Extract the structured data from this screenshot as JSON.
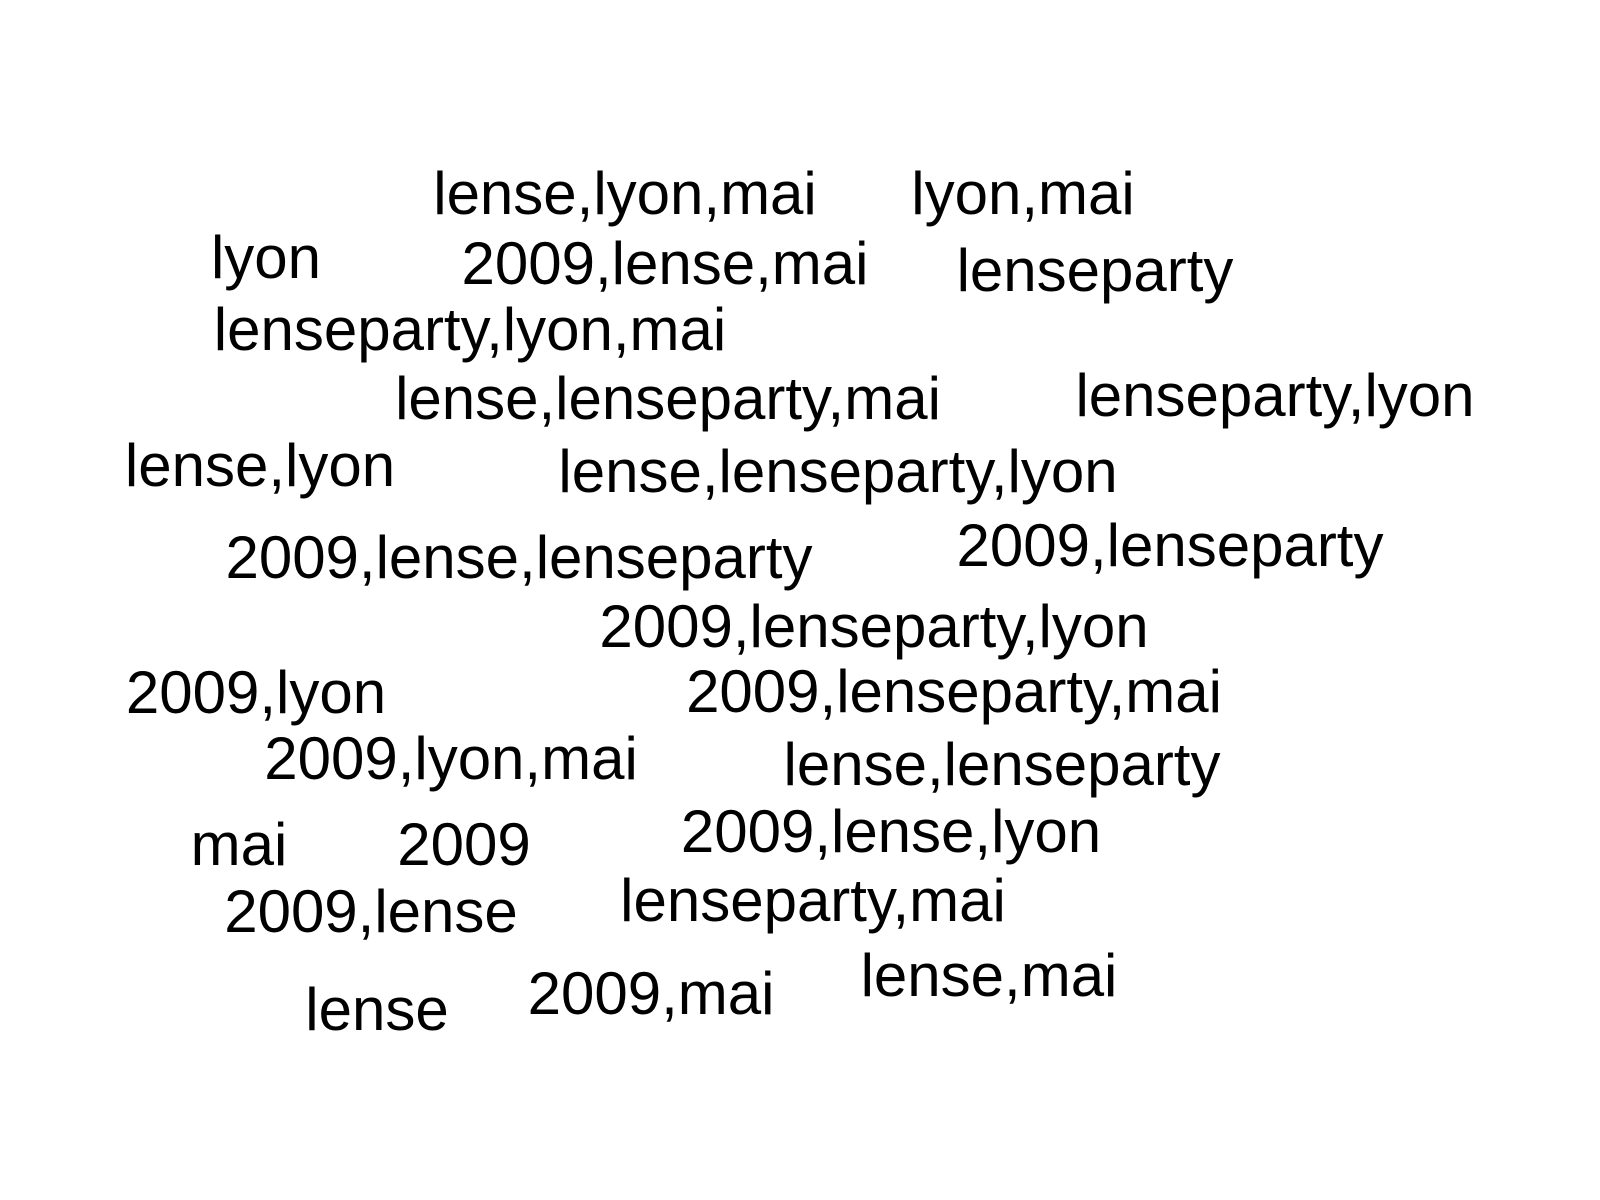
{
  "text_color": "#000000",
  "background_color": "#ffffff",
  "words": [
    "lense,lyon,mai",
    "lyon,mai",
    "lyon",
    "2009,lense,mai",
    "lenseparty",
    "lenseparty,lyon,mai",
    "lense,lenseparty,mai",
    "lenseparty,lyon",
    "lense,lyon",
    "lense,lenseparty,lyon",
    "2009,lense,lenseparty",
    "2009,lenseparty",
    "2009,lenseparty,lyon",
    "2009,lyon",
    "2009,lenseparty,mai",
    "2009,lyon,mai",
    "lense,lenseparty",
    "mai",
    "2009",
    "2009,lense,lyon",
    "2009,lense",
    "lenseparty,mai",
    "lense,mai",
    "lense",
    "2009,mai"
  ]
}
